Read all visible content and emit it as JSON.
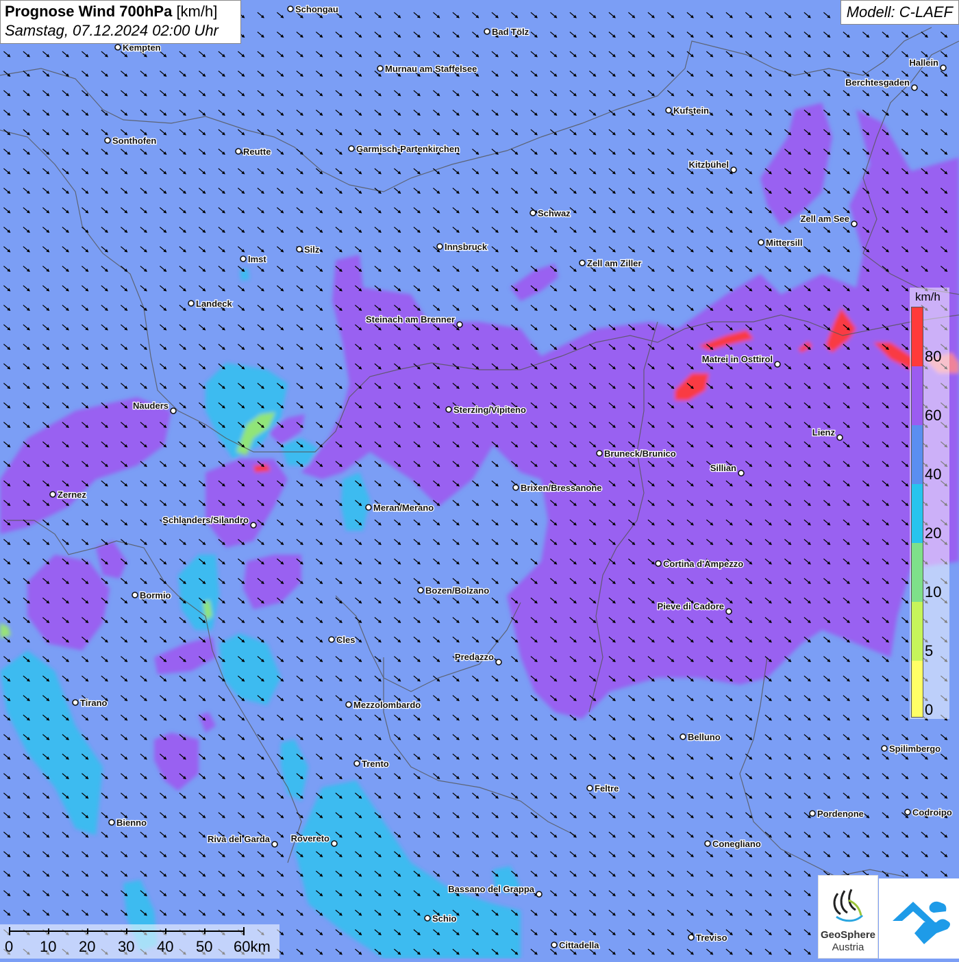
{
  "header": {
    "title_bold": "Prognose Wind 700hPa",
    "title_unit": "[km/h]",
    "datetime": "Samstag, 07.12.2024 02:00 Uhr",
    "model": "Modell: C-LAEF"
  },
  "map_style": {
    "background": "#7b9ef5",
    "arrow_color": "#000000",
    "wind_direction": "from northwest"
  },
  "legend": {
    "unit": "km/h",
    "labels": [
      "80",
      "60",
      "40",
      "20",
      "10",
      "5",
      "0"
    ],
    "colors": [
      "#ff3a3a",
      "#9b5cf0",
      "#5a8ef0",
      "#27c4ee",
      "#7ee08a",
      "#c6f55a",
      "#ffff66"
    ]
  },
  "scale_bar": {
    "labels": [
      "0",
      "10",
      "20",
      "30",
      "40",
      "50",
      "60km"
    ]
  },
  "cities": [
    {
      "name": "Schongau",
      "align": "right"
    },
    {
      "name": "Bad Tölz",
      "align": "right"
    },
    {
      "name": "Kempten",
      "align": "right"
    },
    {
      "name": "Murnau am Staffelsee",
      "align": "right"
    },
    {
      "name": "Hallein",
      "align": "left"
    },
    {
      "name": "Berchtesgaden",
      "align": "left"
    },
    {
      "name": "Kufstein",
      "align": "right"
    },
    {
      "name": "Sonthofen",
      "align": "right"
    },
    {
      "name": "Reutte",
      "align": "right"
    },
    {
      "name": "Garmisch-Partenkirchen",
      "align": "right"
    },
    {
      "name": "Kitzbühel",
      "align": "left"
    },
    {
      "name": "Schwaz",
      "align": "right"
    },
    {
      "name": "Zell am See",
      "align": "left"
    },
    {
      "name": "Mittersill",
      "align": "right"
    },
    {
      "name": "Innsbruck",
      "align": "right"
    },
    {
      "name": "Silz",
      "align": "right"
    },
    {
      "name": "Imst",
      "align": "right"
    },
    {
      "name": "Zell am Ziller",
      "align": "right"
    },
    {
      "name": "Landeck",
      "align": "right"
    },
    {
      "name": "Steinach am Brenner",
      "align": "left"
    },
    {
      "name": "Matrei in Osttirol",
      "align": "left"
    },
    {
      "name": "Nauders",
      "align": "left"
    },
    {
      "name": "Sterzing/Vipiteno",
      "align": "right"
    },
    {
      "name": "Lienz",
      "align": "left"
    },
    {
      "name": "Bruneck/Brunico",
      "align": "right"
    },
    {
      "name": "Sillian",
      "align": "left"
    },
    {
      "name": "Zernez",
      "align": "right"
    },
    {
      "name": "Brixen/Bressanone",
      "align": "right"
    },
    {
      "name": "Meran/Merano",
      "align": "right"
    },
    {
      "name": "Schlanders/Silandro",
      "align": "left"
    },
    {
      "name": "Cortina d'Ampezzo",
      "align": "right"
    },
    {
      "name": "Bozen/Bolzano",
      "align": "right"
    },
    {
      "name": "Bormio",
      "align": "right"
    },
    {
      "name": "Pieve di Cadore",
      "align": "left"
    },
    {
      "name": "Cles",
      "align": "right"
    },
    {
      "name": "Predazzo",
      "align": "left"
    },
    {
      "name": "Tirano",
      "align": "right"
    },
    {
      "name": "Mezzolombardo",
      "align": "right"
    },
    {
      "name": "Belluno",
      "align": "right"
    },
    {
      "name": "Spilimbergo",
      "align": "right"
    },
    {
      "name": "Trento",
      "align": "right"
    },
    {
      "name": "Feltre",
      "align": "right"
    },
    {
      "name": "Pordenone",
      "align": "right"
    },
    {
      "name": "Codroipo",
      "align": "right"
    },
    {
      "name": "Bienno",
      "align": "right"
    },
    {
      "name": "Riva del Garda",
      "align": "left"
    },
    {
      "name": "Rovereto",
      "align": "left"
    },
    {
      "name": "Conegliano",
      "align": "right"
    },
    {
      "name": "Bassano del Grappa",
      "align": "left"
    },
    {
      "name": "Schio",
      "align": "right"
    },
    {
      "name": "Treviso",
      "align": "right"
    },
    {
      "name": "Cittadella",
      "align": "right"
    }
  ],
  "logos": {
    "geosphere_line1": "GeoSphere",
    "geosphere_line2": "Austria"
  }
}
